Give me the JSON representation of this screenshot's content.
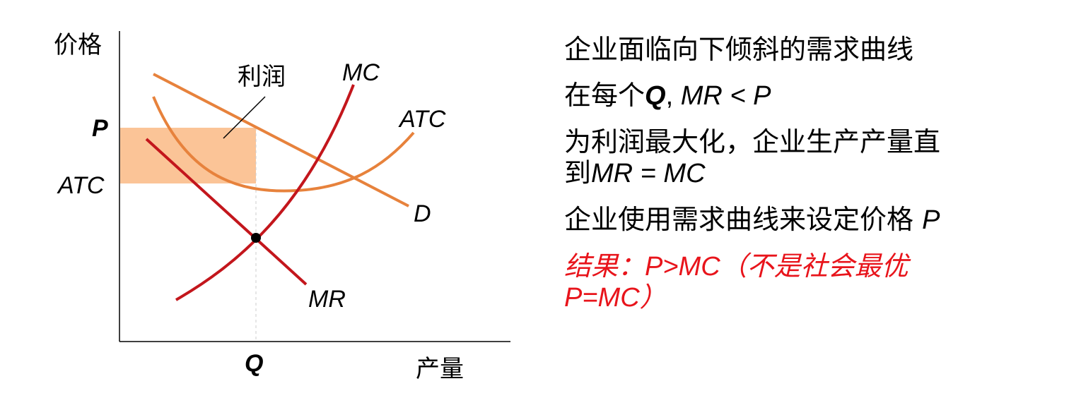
{
  "diagram": {
    "y_axis_label": "价格",
    "x_axis_label": "产量",
    "price_label": "P",
    "atc_level_label": "ATC",
    "quantity_label": "Q",
    "profit_label": "利润",
    "curves": {
      "mc": "MC",
      "atc": "ATC",
      "demand": "D",
      "mr": "MR"
    },
    "colors": {
      "mc_mr": "#c3161c",
      "atc_demand": "#e7823c",
      "profit_fill": "#fbc497"
    }
  },
  "bullets": {
    "b1": "企业面临向下倾斜的需求曲线",
    "b2_prefix": "在每个",
    "b2_q": "Q",
    "b2_sep": ", ",
    "b2_expr": "MR < P",
    "b3_line1": "为利润最大化，企业生产产量直",
    "b3_line2_prefix": "到",
    "b3_line2_expr": "MR = MC",
    "b4_text": "企业使用需求曲线来设定价格 ",
    "b4_p": "P",
    "b5_prefix": "结果：",
    "b5_expr": "P>MC",
    "b5_suffix": "（不是社会最优",
    "b5_line2": "P=MC）"
  }
}
